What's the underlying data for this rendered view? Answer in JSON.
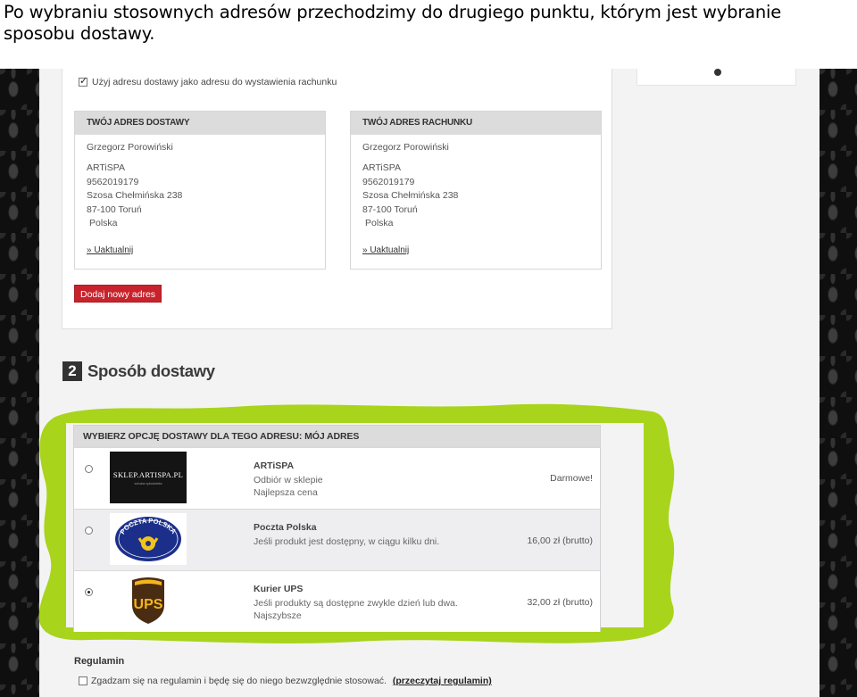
{
  "caption": "Po wybraniu stosownych adresów przechodzimy do drugiego punktu, którym jest wybranie sposobu dostawy.",
  "address": {
    "same_address_label": "Użyj adresu dostawy jako adresu do wystawienia rachunku",
    "same_address_checked": true,
    "shipping": {
      "title": "TWÓJ ADRES DOSTAWY",
      "name": "Grzegorz Porowiński",
      "lines": [
        "ARTiSPA",
        "9562019179",
        "Szosa Chełmińska 238",
        "87-100 Toruń",
        "Polska"
      ],
      "update": "» Uaktualnij"
    },
    "billing": {
      "title": "TWÓJ ADRES RACHUNKU",
      "name": "Grzegorz Porowiński",
      "lines": [
        "ARTiSPA",
        "9562019179",
        "Szosa Chełmińska 238",
        "87-100 Toruń",
        "Polska"
      ],
      "update": "» Uaktualnij"
    },
    "add_button": "Dodaj nowy adres"
  },
  "step": {
    "number": "2",
    "title": "Sposób dostawy"
  },
  "shipping_options": {
    "header": "WYBIERZ OPCJĘ DOSTAWY DLA TEGO ADRESU: MÓJ ADRES",
    "options": [
      {
        "name": "ARTiSPA",
        "desc1": "Odbiór w sklepie",
        "desc2": "Najlepsza cena",
        "price": "Darmowe!",
        "logo_text": "SKLEP.ARTISPA.PL",
        "logo_sub": "sztuka rękodzieła",
        "selected": false
      },
      {
        "name": "Poczta Polska",
        "desc1": "Jeśli produkt jest dostępny, w ciągu kilku dni.",
        "desc2": "",
        "price": "16,00 zł (brutto)",
        "logo_text": "POCZTA POLSKA",
        "selected": false
      },
      {
        "name": "Kurier UPS",
        "desc1": "Jeśli produkty są dostępne zwykle dzień lub dwa.",
        "desc2": "Najszybsze",
        "price": "32,00 zł (brutto)",
        "logo_text": "UPS",
        "selected": true
      }
    ]
  },
  "rules": {
    "title": "Regulamin",
    "agree_text": "Zgadzam się na regulamin i będę się do niego bezwzględnie stosować.",
    "link": "(przeczytaj regulamin)",
    "checked": false
  },
  "colors": {
    "accent_red": "#c8232d",
    "highlight_green": "#a8d41c",
    "damask": "#0f0f0f"
  }
}
